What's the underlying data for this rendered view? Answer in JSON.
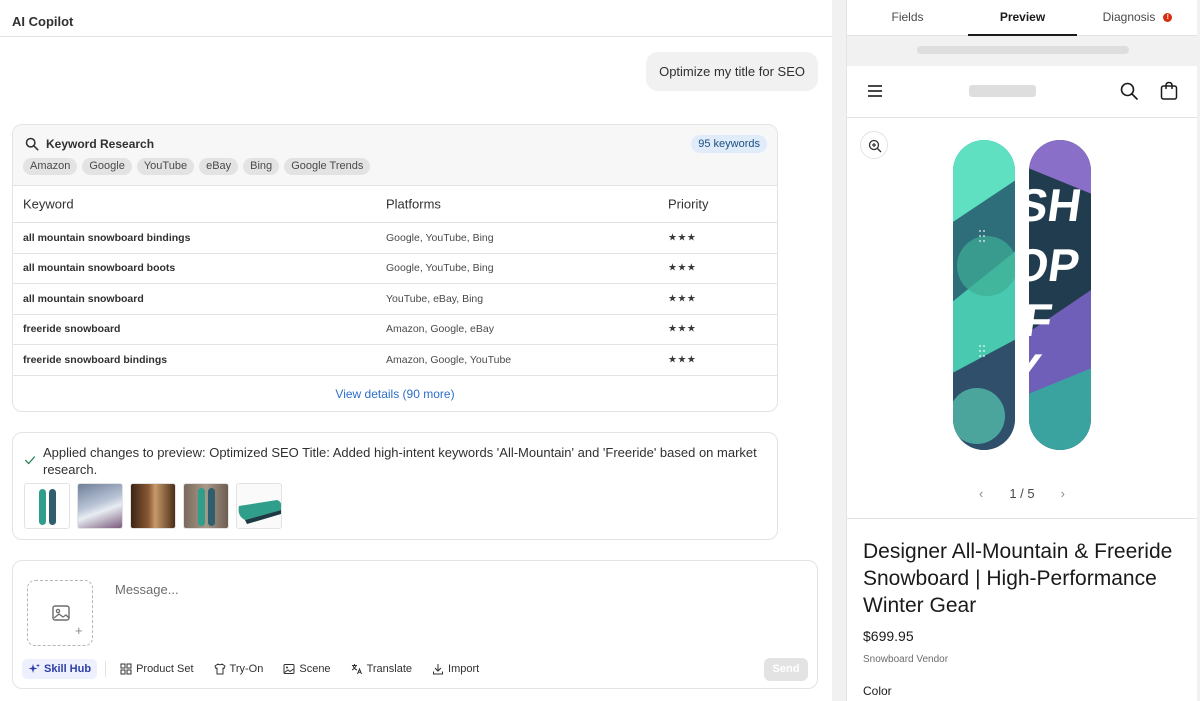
{
  "app": {
    "title": "AI Copilot"
  },
  "chat": {
    "user_message": "Optimize my title for SEO",
    "keyword_research": {
      "title": "Keyword Research",
      "badge": "95 keywords",
      "platforms": [
        "Amazon",
        "Google",
        "YouTube",
        "eBay",
        "Bing",
        "Google Trends"
      ],
      "columns": [
        "Keyword",
        "Platforms",
        "Priority"
      ],
      "rows": [
        {
          "keyword": "all mountain snowboard bindings",
          "platforms": "Google, YouTube, Bing",
          "priority": "★★★"
        },
        {
          "keyword": "all mountain snowboard boots",
          "platforms": "Google, YouTube, Bing",
          "priority": "★★★"
        },
        {
          "keyword": "all mountain snowboard",
          "platforms": "YouTube,  eBay, Bing",
          "priority": "★★★"
        },
        {
          "keyword": "freeride snowboard",
          "platforms": "Amazon, Google,  eBay",
          "priority": "★★★"
        },
        {
          "keyword": "freeride snowboard bindings",
          "platforms": "Amazon, Google, YouTube",
          "priority": "★★★"
        }
      ],
      "view_more": "View details (90 more)"
    },
    "applied": {
      "text": "Applied changes to preview: Optimized SEO Title: Added high-intent keywords 'All-Mountain' and 'Freeride' based on market research."
    }
  },
  "composer": {
    "placeholder": "Message...",
    "tools": {
      "skill_hub": "Skill Hub",
      "product_set": "Product Set",
      "try_on": "Try-On",
      "scene": "Scene",
      "translate": "Translate",
      "import": "Import"
    },
    "send": "Send"
  },
  "preview": {
    "tabs": {
      "fields": "Fields",
      "preview": "Preview",
      "diagnosis": "Diagnosis",
      "diagnosis_alert": "!"
    },
    "pager": "1 / 5",
    "product": {
      "title": "Designer All-Mountain & Freeride Snowboard | High-Performance Winter Gear",
      "price": "$699.95",
      "vendor": "Snowboard Vendor",
      "color_label": "Color"
    }
  },
  "colors": {
    "accent_blue": "#2c6ecb",
    "alert_red": "#d72c0d",
    "skill_hub": "#2c3ea8"
  }
}
